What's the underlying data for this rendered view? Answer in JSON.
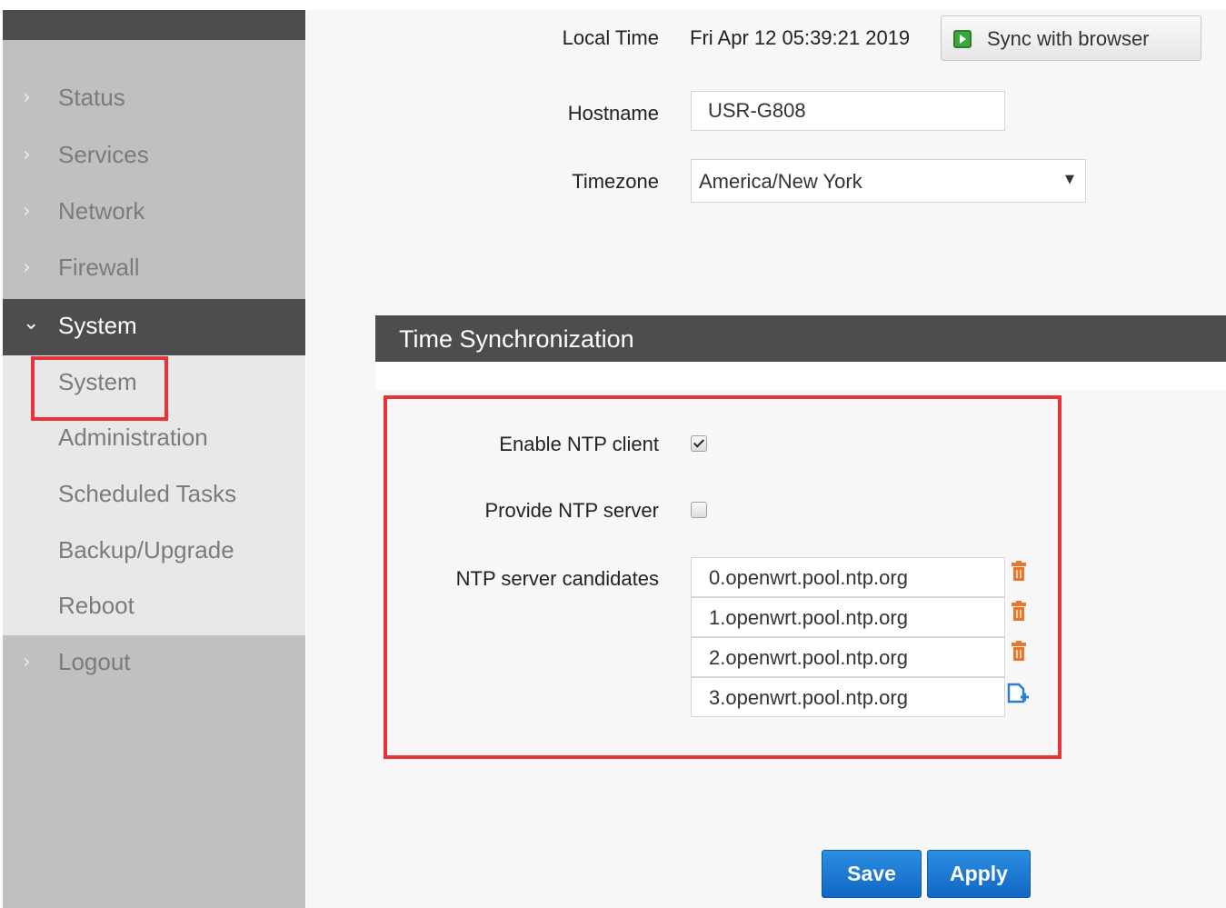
{
  "sidebar": {
    "menu": [
      {
        "label": "Status",
        "chevron": "›"
      },
      {
        "label": "Services",
        "chevron": "›"
      },
      {
        "label": "Network",
        "chevron": "›"
      },
      {
        "label": "Firewall",
        "chevron": "›"
      },
      {
        "label": "System",
        "chevron": "⌄"
      }
    ],
    "submenu": [
      {
        "label": "System"
      },
      {
        "label": "Administration"
      },
      {
        "label": "Scheduled Tasks"
      },
      {
        "label": "Backup/Upgrade"
      },
      {
        "label": "Reboot"
      }
    ],
    "logout": {
      "label": "Logout",
      "chevron": "›"
    }
  },
  "form": {
    "local_time_label": "Local Time",
    "local_time_value": "Fri Apr 12 05:39:21 2019",
    "sync_button": "Sync with browser",
    "hostname_label": "Hostname",
    "hostname_value": "USR-G808",
    "timezone_label": "Timezone",
    "timezone_value": "America/New York",
    "timezone_arrow": "▼"
  },
  "time_sync": {
    "title": "Time Synchronization",
    "enable_ntp_label": "Enable NTP client",
    "enable_ntp_checked": true,
    "provide_ntp_label": "Provide NTP server",
    "provide_ntp_checked": false,
    "candidates_label": "NTP server candidates",
    "candidates": [
      "0.openwrt.pool.ntp.org",
      "1.openwrt.pool.ntp.org",
      "2.openwrt.pool.ntp.org",
      "3.openwrt.pool.ntp.org"
    ]
  },
  "actions": {
    "save": "Save",
    "apply": "Apply"
  },
  "colors": {
    "highlight": "#e8333a",
    "header_bg": "#4d4d4d",
    "primary_button": "#1a78d2",
    "trash": "#e8762b",
    "add_icon": "#2a7fd4"
  }
}
